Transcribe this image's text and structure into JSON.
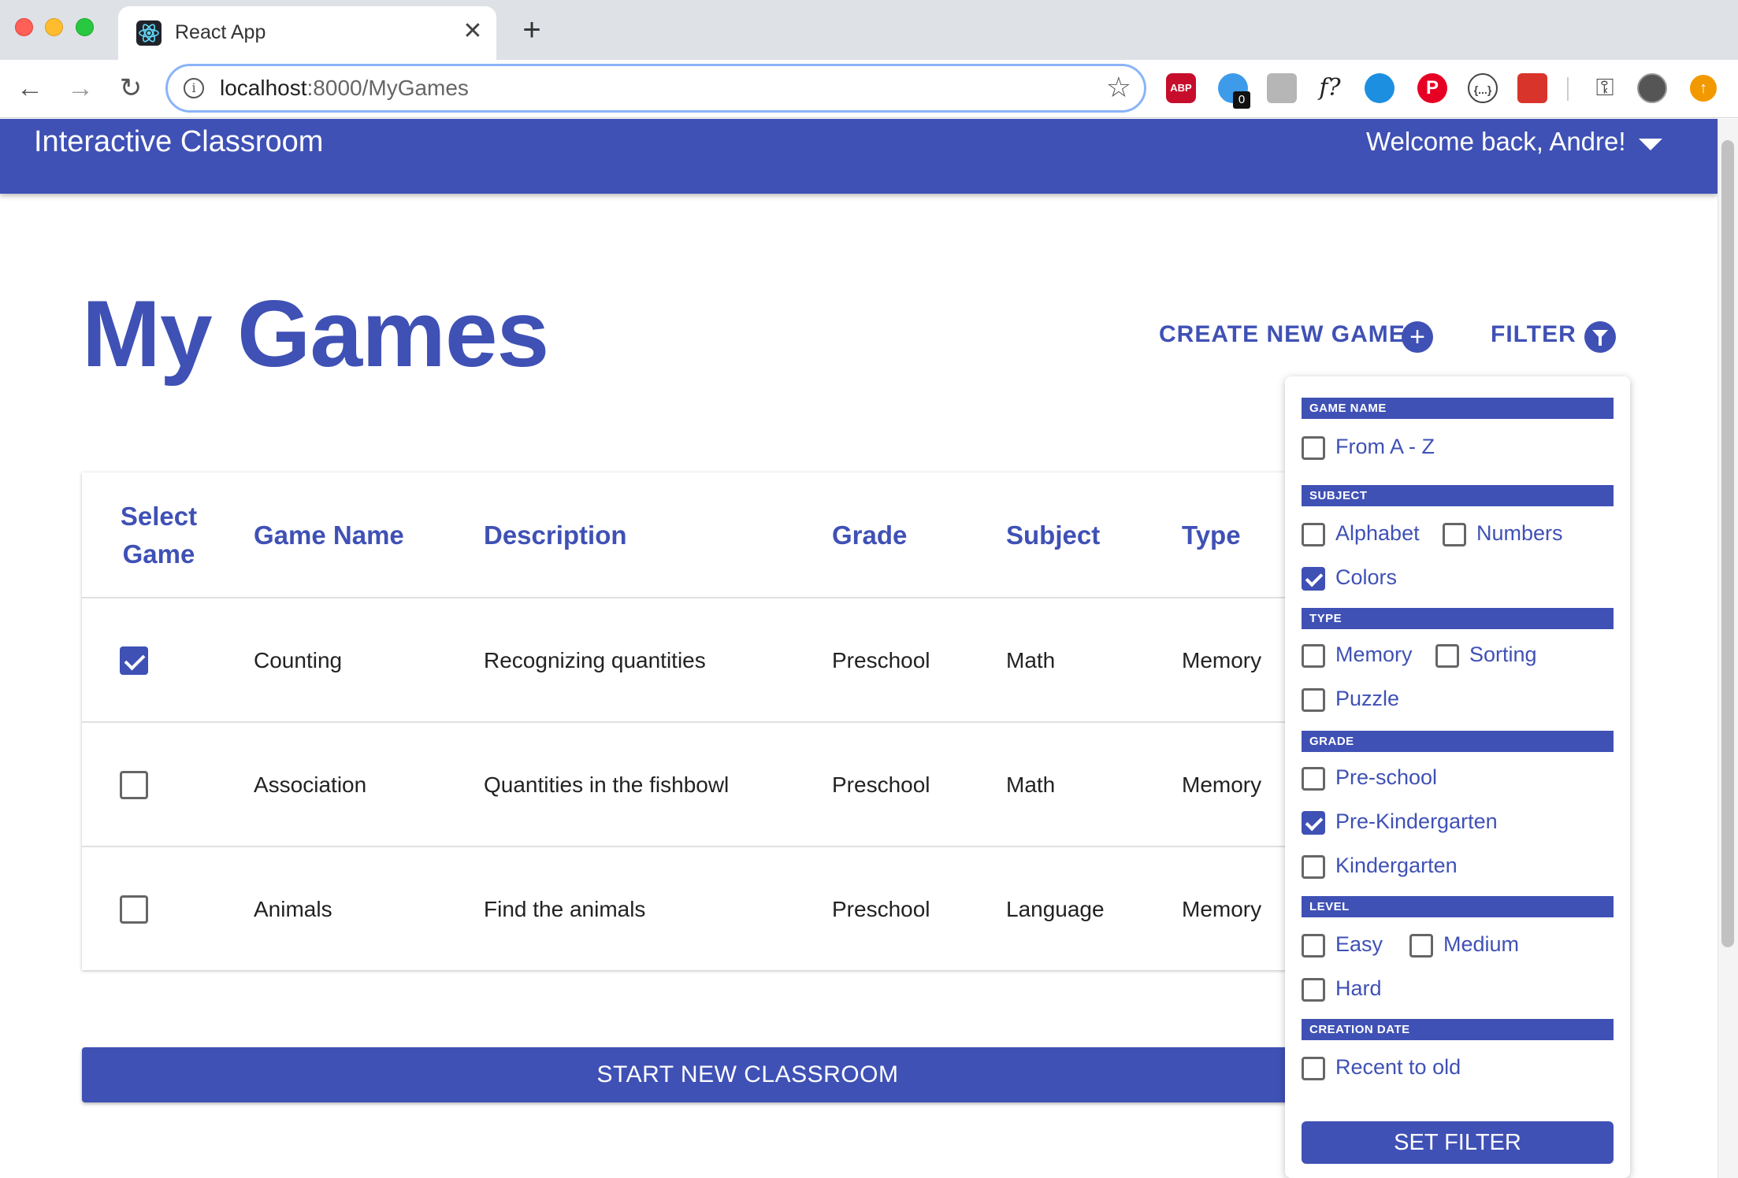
{
  "browser": {
    "tab_title": "React App",
    "tab_close": "✕",
    "new_tab": "+",
    "url_host": "localhost",
    "url_rest": ":8000/MyGames",
    "back": "←",
    "forward": "→",
    "reload": "↻",
    "star": "☆",
    "extensions": {
      "abp": "ABP",
      "ghost_badge": "0",
      "f_label": "f?",
      "pin": "P",
      "code": "{...}",
      "key": "⚿",
      "update": "↑"
    }
  },
  "app": {
    "title": "Interactive Classroom",
    "welcome": "Welcome back, Andre!"
  },
  "page": {
    "title": "My Games",
    "create_label": "CREATE NEW GAME",
    "create_icon": "+",
    "filter_label": "FILTER"
  },
  "table": {
    "headers": {
      "select": "Select Game",
      "name": "Game Name",
      "description": "Description",
      "grade": "Grade",
      "subject": "Subject",
      "type": "Type"
    },
    "rows": [
      {
        "checked": true,
        "name": "Counting",
        "description": "Recognizing quantities",
        "grade": "Preschool",
        "subject": "Math",
        "type": "Memory"
      },
      {
        "checked": false,
        "name": "Association",
        "description": "Quantities in the fishbowl",
        "grade": "Preschool",
        "subject": "Math",
        "type": "Memory"
      },
      {
        "checked": false,
        "name": "Animals",
        "description": "Find the animals",
        "grade": "Preschool",
        "subject": "Language",
        "type": "Memory"
      }
    ]
  },
  "start_button": "START NEW CLASSROOM",
  "filter": {
    "sections": {
      "game_name": "GAME NAME",
      "subject": "SUBJECT",
      "type": "TYPE",
      "grade": "GRADE",
      "level": "LEVEL",
      "creation_date": "CREATION DATE"
    },
    "options": {
      "a_z": {
        "label": "From A - Z",
        "checked": false
      },
      "alphabet": {
        "label": "Alphabet",
        "checked": false
      },
      "numbers": {
        "label": "Numbers",
        "checked": false
      },
      "colors": {
        "label": "Colors",
        "checked": true
      },
      "memory": {
        "label": "Memory",
        "checked": false
      },
      "sorting": {
        "label": "Sorting",
        "checked": false
      },
      "puzzle": {
        "label": "Puzzle",
        "checked": false
      },
      "preschool": {
        "label": "Pre-school",
        "checked": false
      },
      "prek": {
        "label": "Pre-Kindergarten",
        "checked": true
      },
      "kindergarten": {
        "label": "Kindergarten",
        "checked": false
      },
      "easy": {
        "label": "Easy",
        "checked": false
      },
      "medium": {
        "label": "Medium",
        "checked": false
      },
      "hard": {
        "label": "Hard",
        "checked": false
      },
      "recent": {
        "label": "Recent to old",
        "checked": false
      }
    },
    "set_button": "SET FILTER"
  },
  "colors": {
    "primary": "#3f51b5",
    "tabbar": "#dee1e6"
  }
}
